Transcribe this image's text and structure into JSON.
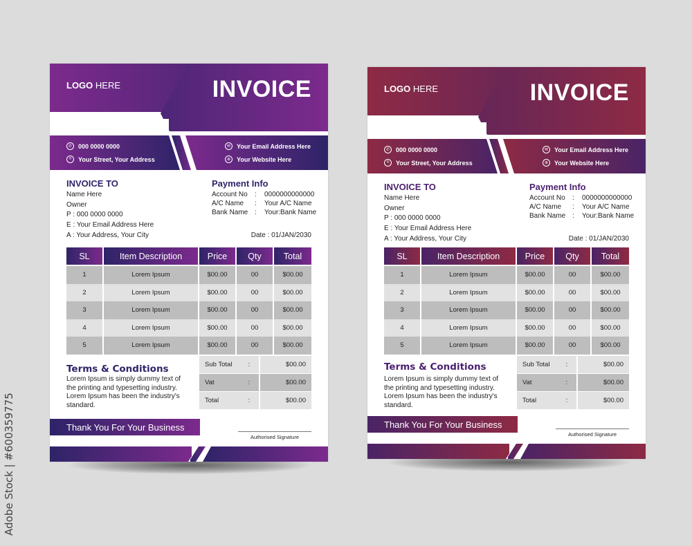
{
  "watermark": "Adobe Stock | #600359775",
  "invoices": [
    {
      "theme": "purple",
      "colors": {
        "dark": "#2e2468",
        "light": "#7c2a8c",
        "title": "#2e2468",
        "row_dark": "#bdbdbd",
        "row_light": "#e2e2e2"
      },
      "header": {
        "logo_bold": "LOGO",
        "logo_rest": " HERE",
        "title": "INVOICE"
      },
      "contact": {
        "phone": "000 0000 0000",
        "address": "Your Street, Your Address",
        "email": "Your Email Address Here",
        "website": "Your Website Here",
        "icons": {
          "phone": "phone-icon",
          "address": "location-pin-icon",
          "email": "envelope-icon",
          "website": "globe-icon"
        }
      },
      "invoice_to": {
        "title": "INVOICE TO",
        "lines": [
          "Name Here",
          "Owner",
          "P : 000 0000 0000",
          "E : Your Email Address Here",
          "A : Your Address, Your City"
        ]
      },
      "payment_info": {
        "title": "Payment Info",
        "rows": [
          {
            "label": "Account No",
            "sep": ":",
            "value": "0000000000000"
          },
          {
            "label": "A/C Name",
            "sep": ":",
            "value": "Your A/C Name"
          },
          {
            "label": "Bank Name",
            "sep": ":",
            "value": "Your:Bank Name"
          }
        ],
        "date": "Date : 01/JAN/2030"
      },
      "table": {
        "headers": [
          "SL",
          "Item Description",
          "Price",
          "Qty",
          "Total"
        ],
        "rows": [
          [
            "1",
            "Lorem Ipsum",
            "$00.00",
            "00",
            "$00.00"
          ],
          [
            "2",
            "Lorem Ipsum",
            "$00.00",
            "00",
            "$00.00"
          ],
          [
            "3",
            "Lorem Ipsum",
            "$00.00",
            "00",
            "$00.00"
          ],
          [
            "4",
            "Lorem Ipsum",
            "$00.00",
            "00",
            "$00.00"
          ],
          [
            "5",
            "Lorem Ipsum",
            "$00.00",
            "00",
            "$00.00"
          ]
        ]
      },
      "totals": [
        {
          "label": "Sub Total",
          "sep": ":",
          "value": "$00.00"
        },
        {
          "label": "Vat",
          "sep": ":",
          "value": "$00.00"
        },
        {
          "label": "Total",
          "sep": ":",
          "value": "$00.00"
        }
      ],
      "terms": {
        "title": "Terms & Conditions",
        "body": "Lorem Ipsum is simply dummy text of the printing and typesetting industry. Lorem Ipsum has been the industry's standard."
      },
      "thanks": "Thank You For Your Business",
      "signature": "Authorised Signature"
    },
    {
      "theme": "maroon",
      "colors": {
        "dark": "#4a2466",
        "light": "#8e2a44",
        "title": "#4a1f6e",
        "row_dark": "#bdbdbd",
        "row_light": "#e2e2e2"
      },
      "header": {
        "logo_bold": "LOGO",
        "logo_rest": " HERE",
        "title": "INVOICE"
      },
      "contact": {
        "phone": "000 0000 0000",
        "address": "Your Street, Your Address",
        "email": "Your Email Address Here",
        "website": "Your Website Here",
        "icons": {
          "phone": "phone-icon",
          "address": "location-pin-icon",
          "email": "envelope-icon",
          "website": "globe-icon"
        }
      },
      "invoice_to": {
        "title": "INVOICE TO",
        "lines": [
          "Name Here",
          "Owner",
          "P : 000 0000 0000",
          "E : Your Email Address Here",
          "A : Your Address, Your City"
        ]
      },
      "payment_info": {
        "title": "Payment Info",
        "rows": [
          {
            "label": "Account No",
            "sep": ":",
            "value": "0000000000000"
          },
          {
            "label": "A/C Name",
            "sep": ":",
            "value": "Your A/C Name"
          },
          {
            "label": "Bank Name",
            "sep": ":",
            "value": "Your:Bank Name"
          }
        ],
        "date": "Date : 01/JAN/2030"
      },
      "table": {
        "headers": [
          "SL",
          "Item Description",
          "Price",
          "Qty",
          "Total"
        ],
        "rows": [
          [
            "1",
            "Lorem Ipsum",
            "$00.00",
            "00",
            "$00.00"
          ],
          [
            "2",
            "Lorem Ipsum",
            "$00.00",
            "00",
            "$00.00"
          ],
          [
            "3",
            "Lorem Ipsum",
            "$00.00",
            "00",
            "$00.00"
          ],
          [
            "4",
            "Lorem Ipsum",
            "$00.00",
            "00",
            "$00.00"
          ],
          [
            "5",
            "Lorem Ipsum",
            "$00.00",
            "00",
            "$00.00"
          ]
        ]
      },
      "totals": [
        {
          "label": "Sub Total",
          "sep": ":",
          "value": "$00.00"
        },
        {
          "label": "Vat",
          "sep": ":",
          "value": "$00.00"
        },
        {
          "label": "Total",
          "sep": ":",
          "value": "$00.00"
        }
      ],
      "terms": {
        "title": "Terms & Conditions",
        "body": "Lorem Ipsum is simply dummy text of the printing and typesetting industry. Lorem Ipsum has been the industry's standard."
      },
      "thanks": "Thank You For Your Business",
      "signature": "Authorised Signature"
    }
  ]
}
